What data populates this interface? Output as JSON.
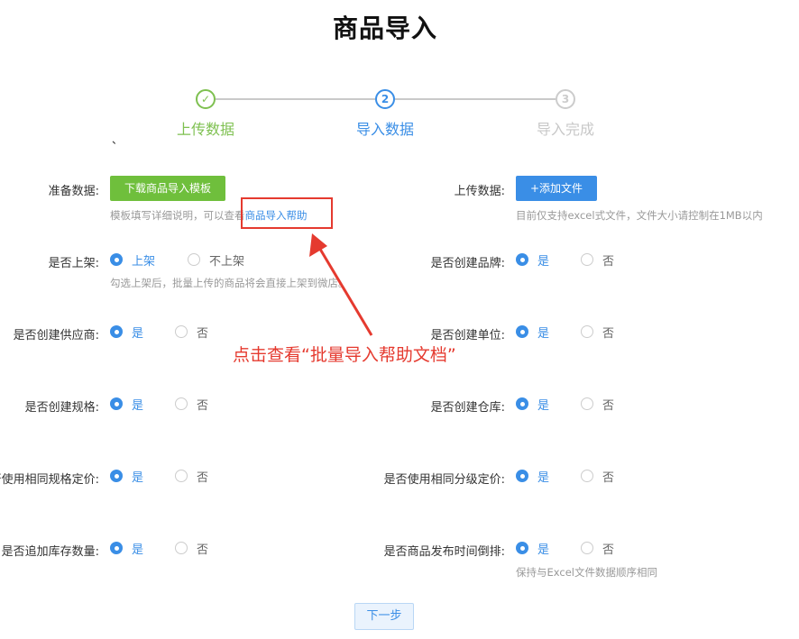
{
  "page_title": "商品导入",
  "steps": [
    {
      "label": "上传数据",
      "number": "✓",
      "state": "done"
    },
    {
      "label": "导入数据",
      "number": "2",
      "state": "active"
    },
    {
      "label": "导入完成",
      "number": "3",
      "state": "todo"
    }
  ],
  "stray_mark": "、",
  "prepare": {
    "label": "准备数据:",
    "button": "下载商品导入模板",
    "hint_prefix": "模板填写详细说明，可以查看",
    "hint_link": "商品导入帮助"
  },
  "upload": {
    "label": "上传数据:",
    "button": "+添加文件",
    "hint": "目前仅支持excel式文件，文件大小请控制在1MB以内"
  },
  "options_left": [
    {
      "label": "是否上架:",
      "yes": "上架",
      "no": "不上架",
      "hint": "勾选上架后，批量上传的商品将会直接上架到微店。"
    },
    {
      "label": "是否创建供应商:",
      "yes": "是",
      "no": "否"
    },
    {
      "label": "是否创建规格:",
      "yes": "是",
      "no": "否"
    },
    {
      "label": "否使用相同规格定价:",
      "yes": "是",
      "no": "否"
    },
    {
      "label": "是否追加库存数量:",
      "yes": "是",
      "no": "否"
    }
  ],
  "options_right": [
    {
      "label": "是否创建品牌:",
      "yes": "是",
      "no": "否"
    },
    {
      "label": "是否创建单位:",
      "yes": "是",
      "no": "否"
    },
    {
      "label": "是否创建仓库:",
      "yes": "是",
      "no": "否"
    },
    {
      "label": "是否使用相同分级定价:",
      "yes": "是",
      "no": "否"
    },
    {
      "label": "是否商品发布时间倒排:",
      "yes": "是",
      "no": "否",
      "hint": "保持与Excel文件数据顺序相同"
    }
  ],
  "next_button": "下一步",
  "annotation": {
    "text": "点击查看“批量导入帮助文档”",
    "color": "#e53a2f"
  },
  "colors": {
    "accent": "#3a8ee6",
    "success": "#6fbf3c"
  }
}
